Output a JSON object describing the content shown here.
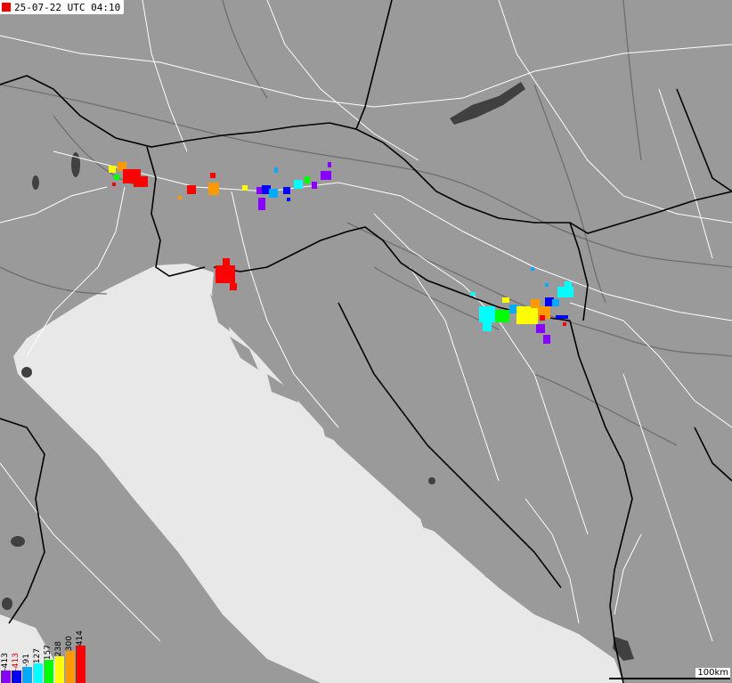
{
  "header": {
    "timestamp": "25-07-22 UTC 04:10",
    "marker_color": "#e00000"
  },
  "colors": {
    "land": "#9a9a9a",
    "sea": "#e8e8e8",
    "lake": "#404040",
    "borders": "#000000",
    "roads": "#ffffff",
    "rivers": "#6e6e6e"
  },
  "legend": [
    {
      "label": "-413",
      "color": "#8800ff"
    },
    {
      "label": "-413",
      "color": "#0000ff"
    },
    {
      "label": "-91",
      "color": "#00aaff"
    },
    {
      "label": "127",
      "color": "#00ffff"
    },
    {
      "label": "157",
      "color": "#00ff00"
    },
    {
      "label": "238",
      "color": "#ffff00"
    },
    {
      "label": "300",
      "color": "#ff9900"
    },
    {
      "label": "414",
      "color": "#ff0000"
    }
  ],
  "scale": {
    "label": "100km"
  }
}
